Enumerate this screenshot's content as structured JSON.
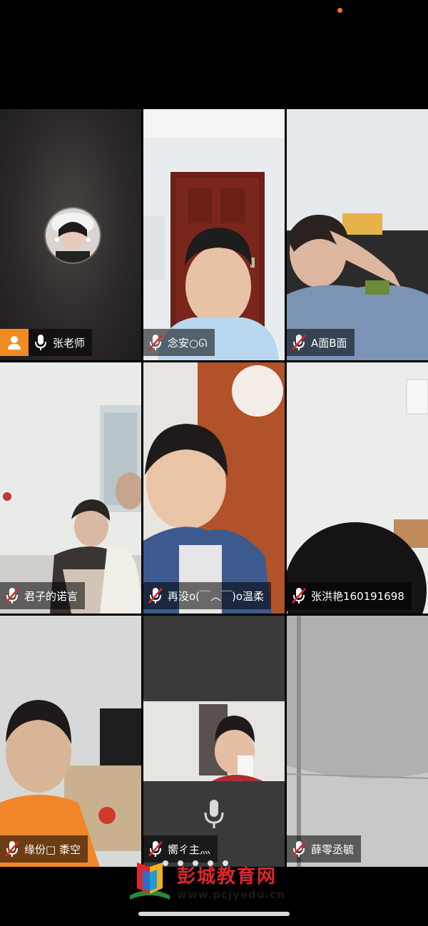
{
  "colors": {
    "accent": "#f08a24",
    "status_dot": "#e8772e",
    "muted_red": "#e0262a"
  },
  "participants": [
    {
      "name": "张老师",
      "mic": "on",
      "role": "host",
      "video": "off",
      "avatar": true
    },
    {
      "name": "念安○ᘏ",
      "mic": "muted",
      "video": "on"
    },
    {
      "name": "A面B面",
      "mic": "muted",
      "video": "on"
    },
    {
      "name": "君子的诺言",
      "mic": "muted",
      "video": "on"
    },
    {
      "name": "再没o(￣︿￣)o温柔",
      "mic": "muted",
      "video": "on"
    },
    {
      "name": "张洪艳160191698",
      "mic": "muted",
      "video": "on"
    },
    {
      "name": "缘份□ 黍空",
      "mic": "muted",
      "video": "on"
    },
    {
      "name": "嚮ㄔ主灬",
      "mic": "muted",
      "video": "on"
    },
    {
      "name": "薛零丞毓",
      "mic": "muted",
      "video": "on"
    }
  ],
  "watermark": {
    "title": "彭城教育网",
    "url": "www.pcjyedu.cn"
  },
  "icons": {
    "host": "person-icon",
    "mic_on": "microphone-icon",
    "mic_muted": "microphone-muted-icon",
    "menu": "menu-icon"
  }
}
